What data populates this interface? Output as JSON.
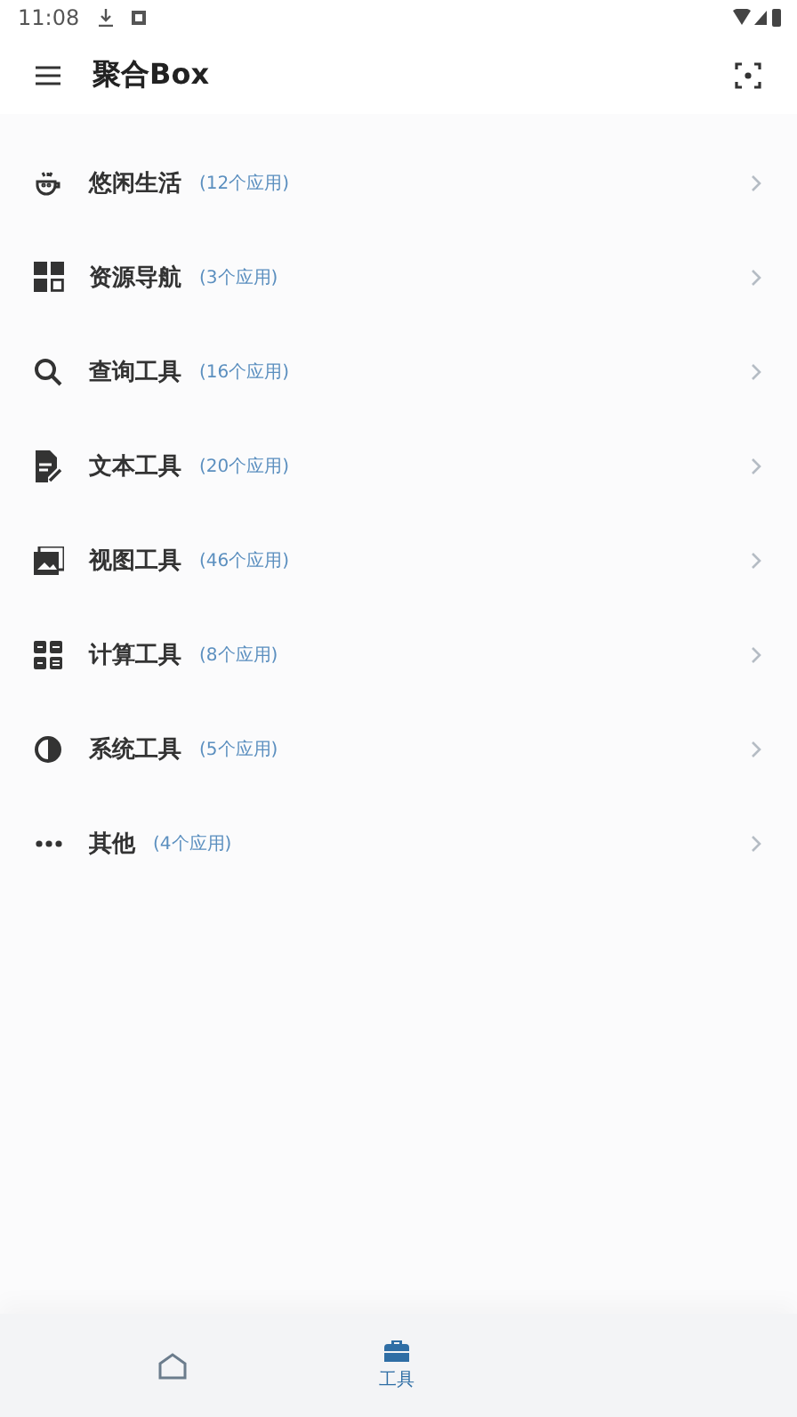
{
  "status_bar": {
    "time": "11:08"
  },
  "app_bar": {
    "title": "聚合Box"
  },
  "categories": [
    {
      "kind": "leisure",
      "name": "悠闲生活",
      "count": "(12个应用)"
    },
    {
      "kind": "navigation",
      "name": "资源导航",
      "count": "(3个应用)"
    },
    {
      "kind": "search",
      "name": "查询工具",
      "count": "(16个应用)"
    },
    {
      "kind": "text",
      "name": "文本工具",
      "count": "(20个应用)"
    },
    {
      "kind": "image",
      "name": "视图工具",
      "count": "(46个应用)"
    },
    {
      "kind": "calculator",
      "name": "计算工具",
      "count": "(8个应用)"
    },
    {
      "kind": "system",
      "name": "系统工具",
      "count": "(5个应用)"
    },
    {
      "kind": "more",
      "name": "其他",
      "count": "(4个应用)"
    }
  ],
  "bottom_nav": [
    {
      "kind": "home",
      "selected": false
    },
    {
      "kind": "tools",
      "label": "工具",
      "selected": true
    }
  ]
}
